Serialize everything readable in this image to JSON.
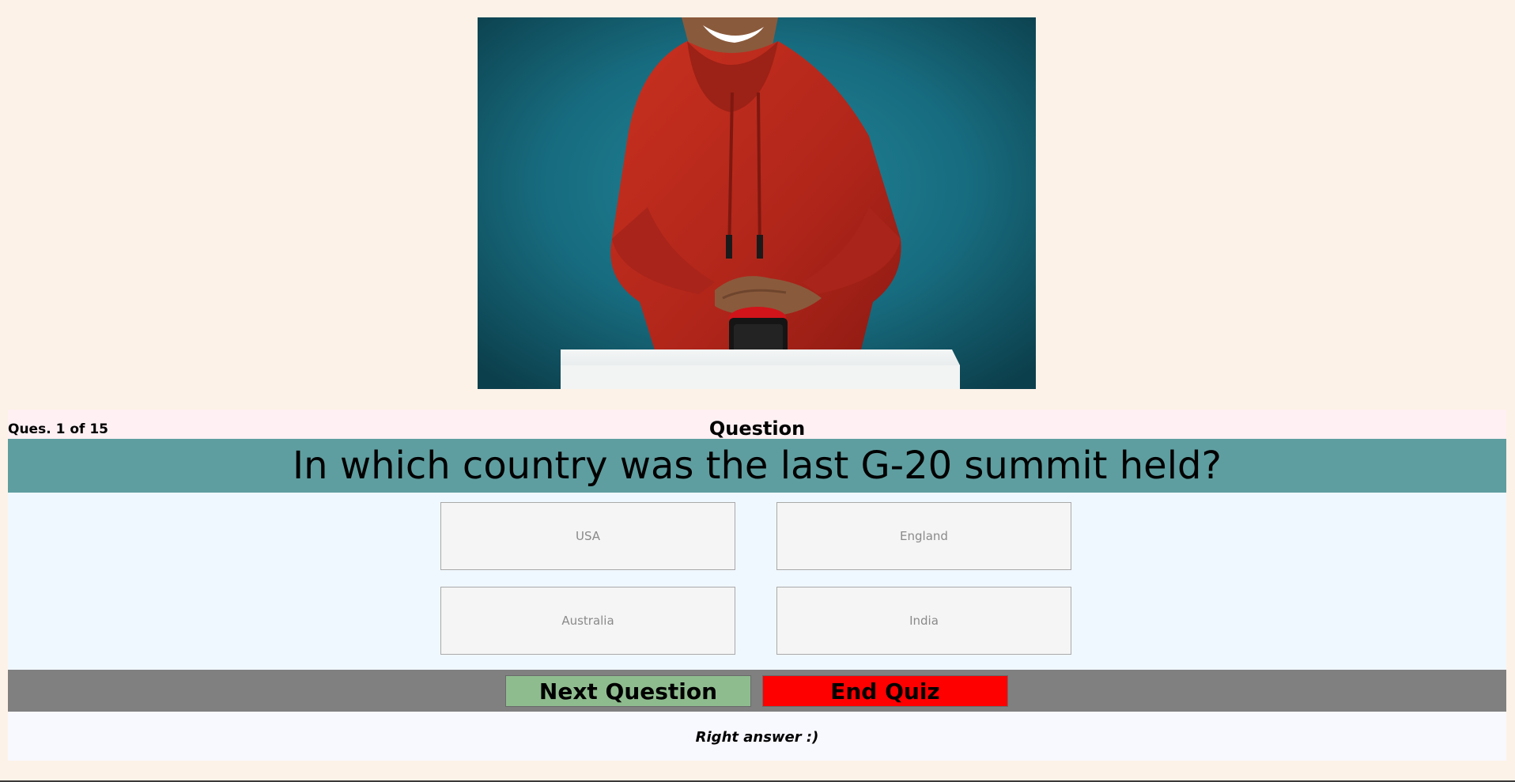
{
  "quiz": {
    "counter": "Ques. 1 of 15",
    "heading": "Question",
    "question_text": "In which country was the last G-20 summit held?",
    "options": [
      "USA",
      "England",
      "Australia",
      "India"
    ],
    "next_label": "Next Question",
    "end_label": "End Quiz",
    "feedback": "Right answer :)"
  },
  "colors": {
    "page_bg": "#fdf2e7",
    "question_band": "#5f9ea0",
    "next_button": "#8fbc8f",
    "end_button": "#ff0000",
    "controls_bar": "#808080"
  },
  "hero": {
    "icon": "quiz-buzzer-photo"
  }
}
